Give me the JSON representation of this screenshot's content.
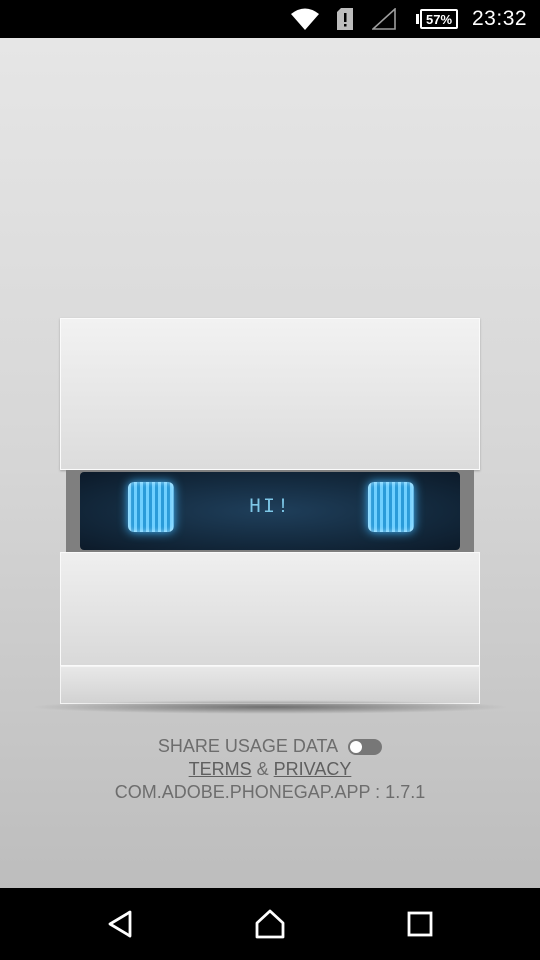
{
  "status_bar": {
    "battery_percent": "57%",
    "time": "23:32",
    "icons": [
      "wifi-icon",
      "sim-alert-icon",
      "signal-icon",
      "battery-icon"
    ]
  },
  "device": {
    "screen_text": "HI!"
  },
  "footer": {
    "share_label": "SHARE USAGE DATA",
    "share_enabled": false,
    "terms_label": "TERMS",
    "and_label": " & ",
    "privacy_label": "PRIVACY",
    "version_text": "COM.ADOBE.PHONEGAP.APP : 1.7.1"
  },
  "nav_bar": {
    "icons": [
      "back-icon",
      "home-icon",
      "recent-apps-icon"
    ]
  },
  "colors": {
    "screen_bg": "#13293d",
    "eye_glow": "#3fb7ff",
    "screen_text": "#7ec8e8",
    "info_text": "#6d6d6d"
  }
}
